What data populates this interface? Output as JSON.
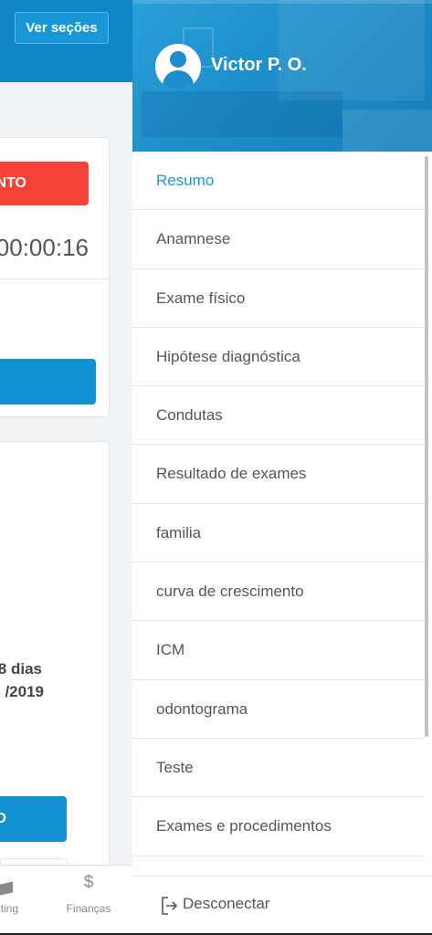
{
  "background_app": {
    "sections_button": "Ver seções",
    "red_button_fragment": "NTO",
    "timer": "00:00:16",
    "days_fragment": "8 dias",
    "date_fragment": "/2019",
    "blue_button_fragment": "O",
    "nav": {
      "marketing_fragment": "eting",
      "finance_label": "Finanças",
      "finance_icon": "$"
    }
  },
  "drawer": {
    "user_name": "Victor P. O.",
    "menu": [
      {
        "label": "Resumo",
        "active": true
      },
      {
        "label": "Anamnese"
      },
      {
        "label": "Exame físico"
      },
      {
        "label": "Hipótese diagnóstica"
      },
      {
        "label": "Condutas"
      },
      {
        "label": "Resultado de exames"
      },
      {
        "label": "familia"
      },
      {
        "label": "curva de crescimento"
      },
      {
        "label": "ICM"
      },
      {
        "label": "odontograma"
      },
      {
        "label": "Teste"
      },
      {
        "label": "Exames e procedimentos"
      }
    ],
    "logout_label": "Desconectar"
  },
  "colors": {
    "primary": "#1290d2",
    "danger": "#f44336",
    "active_menu": "#1a96d4"
  }
}
